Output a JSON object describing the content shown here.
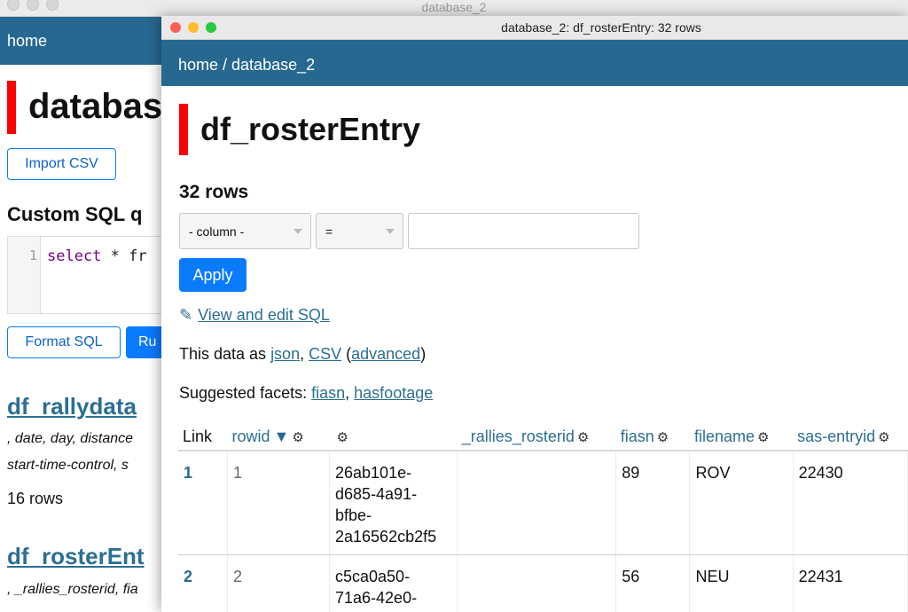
{
  "back_window": {
    "title": "database_2",
    "nav_home": "home",
    "heading": "databas",
    "import_csv": "Import CSV",
    "custom_sql_heading": "Custom SQL q",
    "editor_line_number": "1",
    "editor_keyword": "select",
    "editor_rest": " * fr",
    "format_sql": "Format SQL",
    "run_button": "Ru",
    "tables": [
      {
        "name": "df_rallydata",
        "columns_line1": ", date, day, distance",
        "columns_line2": "start-time-control, s",
        "rows": "16 rows"
      },
      {
        "name": "df_rosterEnt",
        "columns_line1": ", _rallies_rosterid, fia"
      }
    ]
  },
  "front_window": {
    "title": "database_2: df_rosterEntry: 32 rows",
    "breadcrumb": "home / database_2",
    "heading": "df_rosterEntry",
    "row_count": "32 rows",
    "filter": {
      "column_select": "- column -",
      "op_select": "=",
      "value_input": ""
    },
    "apply": "Apply",
    "view_edit_sql": "View and edit SQL",
    "data_as": {
      "prefix": "This data as ",
      "json": "json",
      "sep": ", ",
      "csv": "CSV",
      "open_paren": " (",
      "advanced": "advanced",
      "close_paren": ")"
    },
    "suggested": {
      "prefix": "Suggested facets: ",
      "fiasn": "fiasn",
      "sep": ", ",
      "hasfootage": "hasfootage"
    },
    "table": {
      "headers": [
        "Link",
        "rowid",
        "",
        "_rallies_rosterid",
        "fiasn",
        "filename",
        "sas-entryid"
      ],
      "rows": [
        {
          "link": "1",
          "rowid": "1",
          "id_lines": [
            "26ab101e-",
            "d685-4a91-",
            "bfbe-",
            "2a16562cb2f5"
          ],
          "rosterid": "",
          "fiasn": "89",
          "filename": "ROV",
          "entryid": "22430"
        },
        {
          "link": "2",
          "rowid": "2",
          "id_lines": [
            "c5ca0a50-",
            "71a6-42e0-"
          ],
          "rosterid": "",
          "fiasn": "56",
          "filename": "NEU",
          "entryid": "22431"
        }
      ]
    }
  }
}
